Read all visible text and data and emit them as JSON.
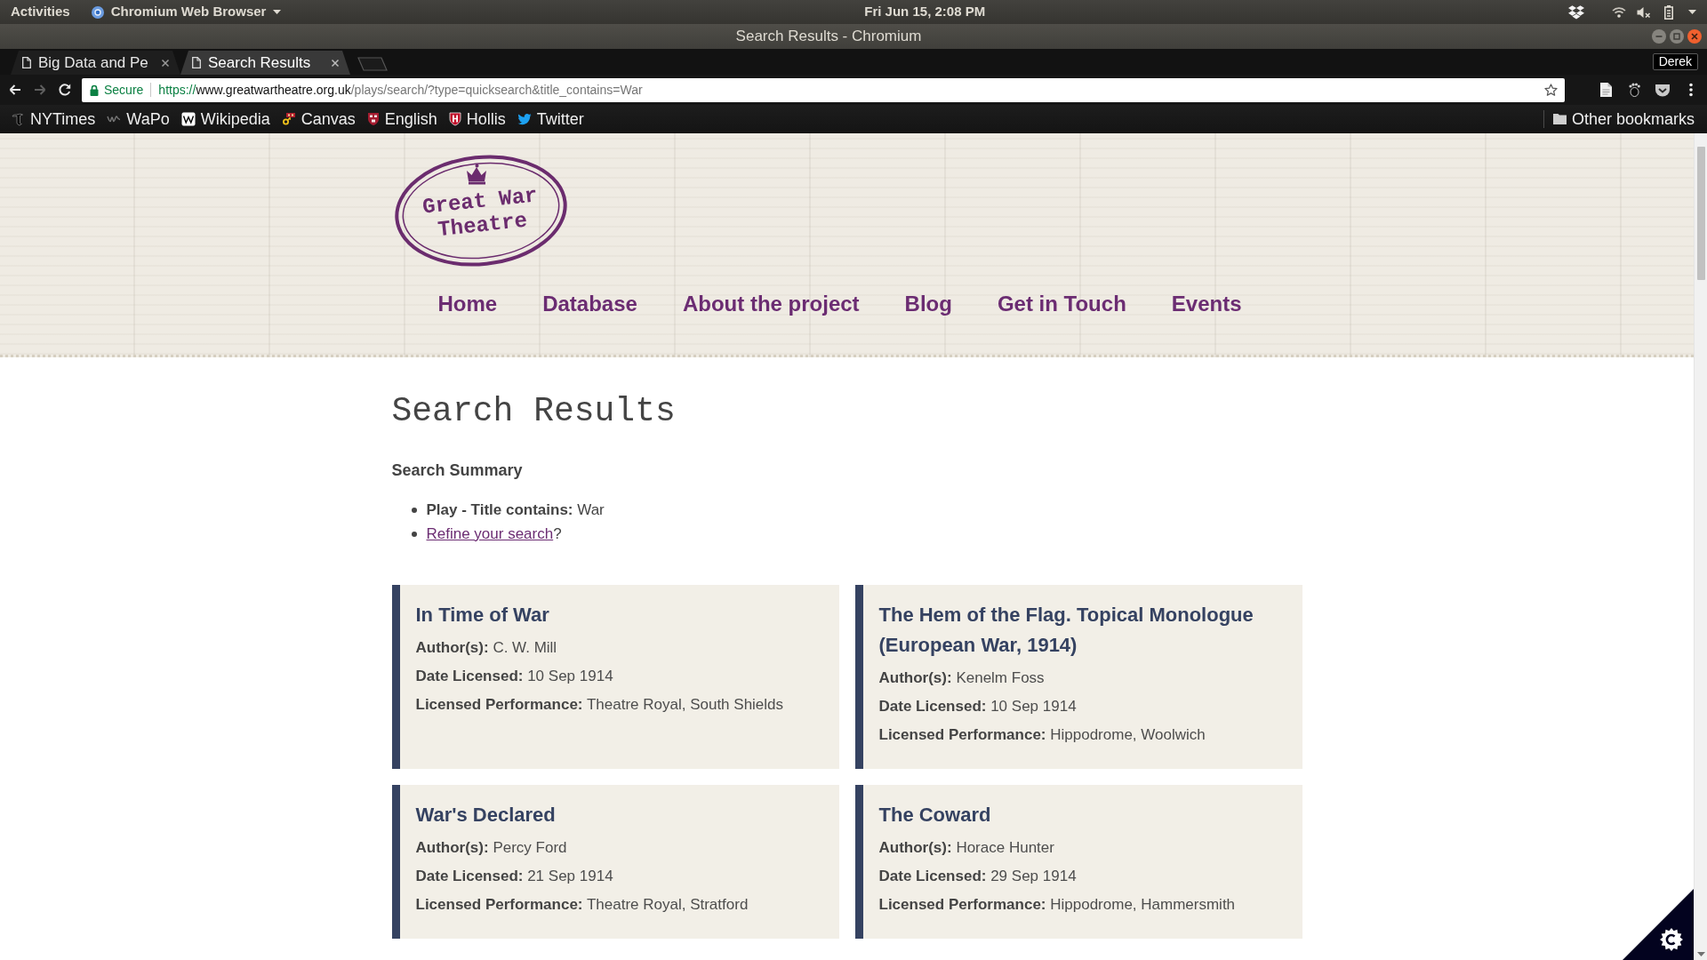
{
  "system_bar": {
    "activities": "Activities",
    "app_menu": "Chromium Web Browser",
    "clock": "Fri Jun 15, 2:08 PM"
  },
  "window": {
    "title": "Search Results - Chromium"
  },
  "tabs": [
    {
      "label": "Big Data and Pe",
      "selected": false
    },
    {
      "label": "Search Results",
      "selected": true
    }
  ],
  "profile": {
    "name": "Derek"
  },
  "toolbar": {
    "nav_buttons": [
      {
        "kind": "back",
        "disabled": false
      },
      {
        "kind": "forward",
        "disabled": true
      },
      {
        "kind": "reload",
        "disabled": false
      }
    ],
    "address": {
      "security": "Secure",
      "scheme": "https://",
      "host": "www.greatwartheatre.org.uk",
      "path": "/plays/search/?type=quicksearch&title_contains=War"
    }
  },
  "bookmarks": {
    "items": [
      {
        "label": "NYTimes",
        "kind": "letter"
      },
      {
        "label": "WaPo",
        "kind": "script"
      },
      {
        "label": "Wikipedia",
        "kind": "tile"
      },
      {
        "label": "Canvas",
        "kind": "key"
      },
      {
        "label": "English",
        "kind": "crest"
      },
      {
        "label": "Hollis",
        "kind": "hshield"
      },
      {
        "label": "Twitter",
        "kind": "bird"
      }
    ],
    "other": "Other bookmarks"
  },
  "site": {
    "logo": [
      "Great War",
      "Theatre"
    ],
    "nav": [
      {
        "label": "Home"
      },
      {
        "label": "Database"
      },
      {
        "label": "About the project"
      },
      {
        "label": "Blog"
      },
      {
        "label": "Get in Touch"
      },
      {
        "label": "Events"
      }
    ]
  },
  "content": {
    "heading": "Search Results",
    "summary_title": "Search Summary",
    "summary": [
      {
        "kind": "criterion",
        "text": "**Play - Title contains:** War"
      },
      {
        "kind": "link",
        "link": "Refine your search",
        "after": "?"
      }
    ]
  },
  "results": [
    {
      "title": "In Time of War",
      "fields": [
        {
          "label": "Author(s):",
          "value": "C. W. Mill"
        },
        {
          "label": "Date Licensed:",
          "value": "10 Sep 1914"
        },
        {
          "label": "Licensed Performance:",
          "value": "Theatre Royal, South Shields"
        }
      ]
    },
    {
      "title": "The Hem of the Flag. Topical Monologue (European War, 1914)",
      "fields": [
        {
          "label": "Author(s):",
          "value": "Kenelm Foss"
        },
        {
          "label": "Date Licensed:",
          "value": "10 Sep 1914"
        },
        {
          "label": "Licensed Performance:",
          "value": "Hippodrome, Woolwich"
        }
      ]
    },
    {
      "title": "War's Declared",
      "fields": [
        {
          "label": "Author(s):",
          "value": "Percy Ford"
        },
        {
          "label": "Date Licensed:",
          "value": "21 Sep 1914"
        },
        {
          "label": "Licensed Performance:",
          "value": "Theatre Royal, Stratford"
        }
      ]
    },
    {
      "title": "The Coward",
      "fields": [
        {
          "label": "Author(s):",
          "value": "Horace Hunter"
        },
        {
          "label": "Date Licensed:",
          "value": "29 Sep 1914"
        },
        {
          "label": "Licensed Performance:",
          "value": "Hippodrome, Hammersmith"
        }
      ]
    }
  ]
}
